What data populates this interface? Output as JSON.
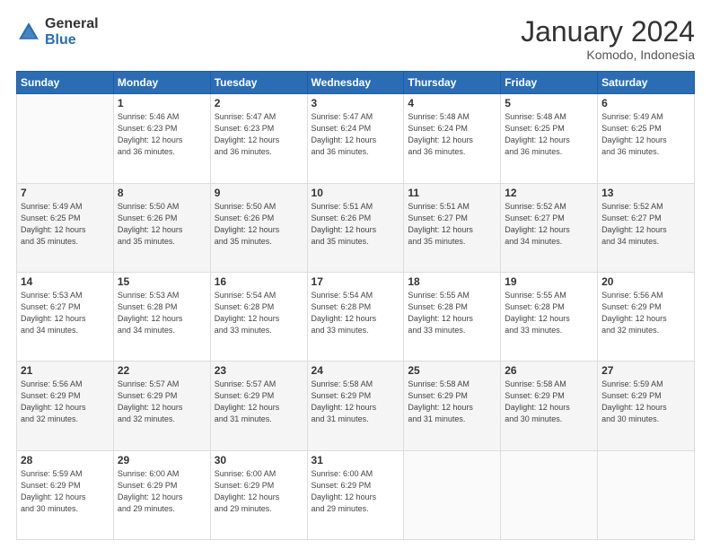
{
  "header": {
    "logo_general": "General",
    "logo_blue": "Blue",
    "month_year": "January 2024",
    "location": "Komodo, Indonesia"
  },
  "weekdays": [
    "Sunday",
    "Monday",
    "Tuesday",
    "Wednesday",
    "Thursday",
    "Friday",
    "Saturday"
  ],
  "weeks": [
    [
      {
        "num": "",
        "info": ""
      },
      {
        "num": "1",
        "info": "Sunrise: 5:46 AM\nSunset: 6:23 PM\nDaylight: 12 hours\nand 36 minutes."
      },
      {
        "num": "2",
        "info": "Sunrise: 5:47 AM\nSunset: 6:23 PM\nDaylight: 12 hours\nand 36 minutes."
      },
      {
        "num": "3",
        "info": "Sunrise: 5:47 AM\nSunset: 6:24 PM\nDaylight: 12 hours\nand 36 minutes."
      },
      {
        "num": "4",
        "info": "Sunrise: 5:48 AM\nSunset: 6:24 PM\nDaylight: 12 hours\nand 36 minutes."
      },
      {
        "num": "5",
        "info": "Sunrise: 5:48 AM\nSunset: 6:25 PM\nDaylight: 12 hours\nand 36 minutes."
      },
      {
        "num": "6",
        "info": "Sunrise: 5:49 AM\nSunset: 6:25 PM\nDaylight: 12 hours\nand 36 minutes."
      }
    ],
    [
      {
        "num": "7",
        "info": "Sunrise: 5:49 AM\nSunset: 6:25 PM\nDaylight: 12 hours\nand 35 minutes."
      },
      {
        "num": "8",
        "info": "Sunrise: 5:50 AM\nSunset: 6:26 PM\nDaylight: 12 hours\nand 35 minutes."
      },
      {
        "num": "9",
        "info": "Sunrise: 5:50 AM\nSunset: 6:26 PM\nDaylight: 12 hours\nand 35 minutes."
      },
      {
        "num": "10",
        "info": "Sunrise: 5:51 AM\nSunset: 6:26 PM\nDaylight: 12 hours\nand 35 minutes."
      },
      {
        "num": "11",
        "info": "Sunrise: 5:51 AM\nSunset: 6:27 PM\nDaylight: 12 hours\nand 35 minutes."
      },
      {
        "num": "12",
        "info": "Sunrise: 5:52 AM\nSunset: 6:27 PM\nDaylight: 12 hours\nand 34 minutes."
      },
      {
        "num": "13",
        "info": "Sunrise: 5:52 AM\nSunset: 6:27 PM\nDaylight: 12 hours\nand 34 minutes."
      }
    ],
    [
      {
        "num": "14",
        "info": "Sunrise: 5:53 AM\nSunset: 6:27 PM\nDaylight: 12 hours\nand 34 minutes."
      },
      {
        "num": "15",
        "info": "Sunrise: 5:53 AM\nSunset: 6:28 PM\nDaylight: 12 hours\nand 34 minutes."
      },
      {
        "num": "16",
        "info": "Sunrise: 5:54 AM\nSunset: 6:28 PM\nDaylight: 12 hours\nand 33 minutes."
      },
      {
        "num": "17",
        "info": "Sunrise: 5:54 AM\nSunset: 6:28 PM\nDaylight: 12 hours\nand 33 minutes."
      },
      {
        "num": "18",
        "info": "Sunrise: 5:55 AM\nSunset: 6:28 PM\nDaylight: 12 hours\nand 33 minutes."
      },
      {
        "num": "19",
        "info": "Sunrise: 5:55 AM\nSunset: 6:28 PM\nDaylight: 12 hours\nand 33 minutes."
      },
      {
        "num": "20",
        "info": "Sunrise: 5:56 AM\nSunset: 6:29 PM\nDaylight: 12 hours\nand 32 minutes."
      }
    ],
    [
      {
        "num": "21",
        "info": "Sunrise: 5:56 AM\nSunset: 6:29 PM\nDaylight: 12 hours\nand 32 minutes."
      },
      {
        "num": "22",
        "info": "Sunrise: 5:57 AM\nSunset: 6:29 PM\nDaylight: 12 hours\nand 32 minutes."
      },
      {
        "num": "23",
        "info": "Sunrise: 5:57 AM\nSunset: 6:29 PM\nDaylight: 12 hours\nand 31 minutes."
      },
      {
        "num": "24",
        "info": "Sunrise: 5:58 AM\nSunset: 6:29 PM\nDaylight: 12 hours\nand 31 minutes."
      },
      {
        "num": "25",
        "info": "Sunrise: 5:58 AM\nSunset: 6:29 PM\nDaylight: 12 hours\nand 31 minutes."
      },
      {
        "num": "26",
        "info": "Sunrise: 5:58 AM\nSunset: 6:29 PM\nDaylight: 12 hours\nand 30 minutes."
      },
      {
        "num": "27",
        "info": "Sunrise: 5:59 AM\nSunset: 6:29 PM\nDaylight: 12 hours\nand 30 minutes."
      }
    ],
    [
      {
        "num": "28",
        "info": "Sunrise: 5:59 AM\nSunset: 6:29 PM\nDaylight: 12 hours\nand 30 minutes."
      },
      {
        "num": "29",
        "info": "Sunrise: 6:00 AM\nSunset: 6:29 PM\nDaylight: 12 hours\nand 29 minutes."
      },
      {
        "num": "30",
        "info": "Sunrise: 6:00 AM\nSunset: 6:29 PM\nDaylight: 12 hours\nand 29 minutes."
      },
      {
        "num": "31",
        "info": "Sunrise: 6:00 AM\nSunset: 6:29 PM\nDaylight: 12 hours\nand 29 minutes."
      },
      {
        "num": "",
        "info": ""
      },
      {
        "num": "",
        "info": ""
      },
      {
        "num": "",
        "info": ""
      }
    ]
  ]
}
